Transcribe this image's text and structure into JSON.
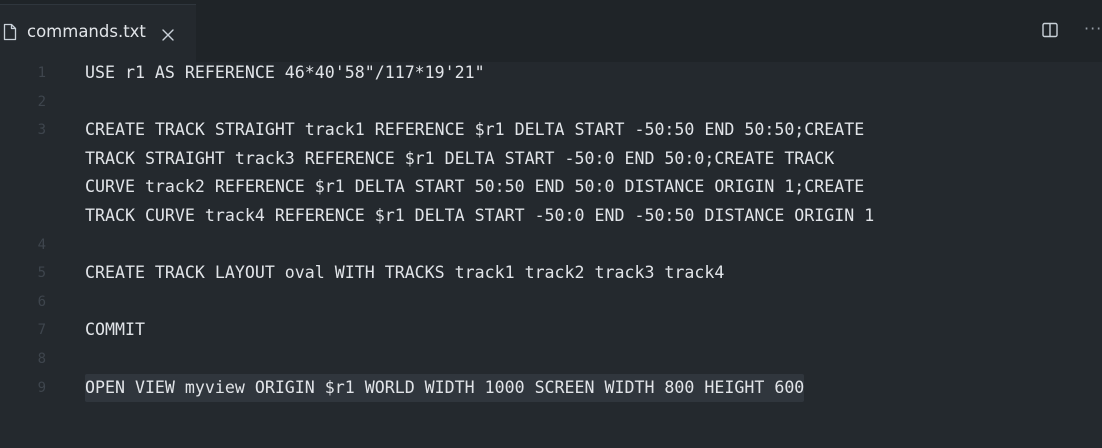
{
  "tab": {
    "title": "commands.txt"
  },
  "toolbar": {
    "more_label": "···"
  },
  "icons": {
    "file": "file-icon",
    "close": "close-icon",
    "split": "split-editor-icon",
    "more": "more-actions-icon"
  },
  "editor": {
    "lines": [
      {
        "number": "1",
        "text": "USE r1 AS REFERENCE 46*40'58\"/117*19'21\""
      },
      {
        "number": "2",
        "text": ""
      },
      {
        "number": "3",
        "text": "CREATE TRACK STRAIGHT track1 REFERENCE $r1 DELTA START -50:50 END 50:50;CREATE"
      },
      {
        "number": "",
        "text": "TRACK STRAIGHT track3 REFERENCE $r1 DELTA START -50:0 END 50:0;CREATE TRACK"
      },
      {
        "number": "",
        "text": "CURVE track2 REFERENCE $r1 DELTA START 50:50 END 50:0 DISTANCE ORIGIN 1;CREATE"
      },
      {
        "number": "",
        "text": "TRACK CURVE track4 REFERENCE $r1 DELTA START -50:0 END -50:50 DISTANCE ORIGIN 1"
      },
      {
        "number": "4",
        "text": ""
      },
      {
        "number": "5",
        "text": "CREATE TRACK LAYOUT oval WITH TRACKS track1 track2 track3 track4"
      },
      {
        "number": "6",
        "text": ""
      },
      {
        "number": "7",
        "text": "COMMIT"
      },
      {
        "number": "8",
        "text": ""
      },
      {
        "number": "9",
        "text": "OPEN VIEW myview ORIGIN $r1 WORLD WIDTH 1000 SCREEN WIDTH 800 HEIGHT 600"
      }
    ]
  },
  "colors": {
    "background": "#24292e",
    "tabbar": "#1f2428",
    "text": "#e1e4e8",
    "gutter": "#3e454d",
    "selection": "#30363d"
  }
}
